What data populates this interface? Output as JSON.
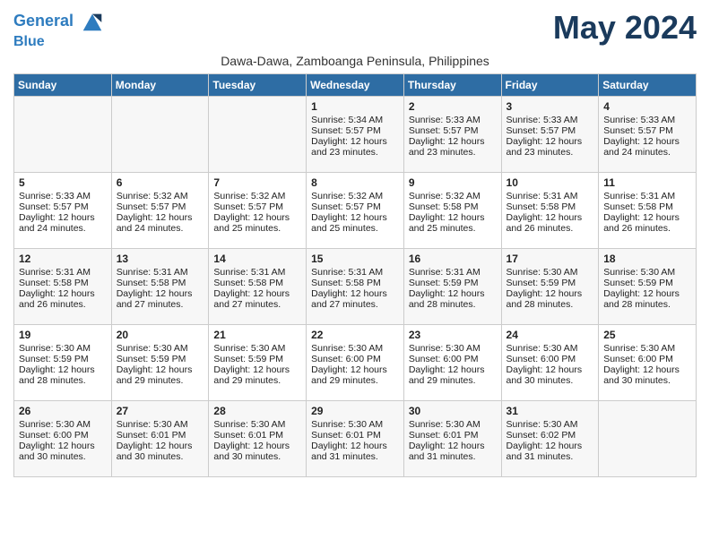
{
  "header": {
    "logo_line1": "General",
    "logo_line2": "Blue",
    "month_year": "May 2024",
    "location": "Dawa-Dawa, Zamboanga Peninsula, Philippines"
  },
  "days_of_week": [
    "Sunday",
    "Monday",
    "Tuesday",
    "Wednesday",
    "Thursday",
    "Friday",
    "Saturday"
  ],
  "weeks": [
    [
      {
        "day": "",
        "content": ""
      },
      {
        "day": "",
        "content": ""
      },
      {
        "day": "",
        "content": ""
      },
      {
        "day": "1",
        "sunrise": "Sunrise: 5:34 AM",
        "sunset": "Sunset: 5:57 PM",
        "daylight": "Daylight: 12 hours and 23 minutes."
      },
      {
        "day": "2",
        "sunrise": "Sunrise: 5:33 AM",
        "sunset": "Sunset: 5:57 PM",
        "daylight": "Daylight: 12 hours and 23 minutes."
      },
      {
        "day": "3",
        "sunrise": "Sunrise: 5:33 AM",
        "sunset": "Sunset: 5:57 PM",
        "daylight": "Daylight: 12 hours and 23 minutes."
      },
      {
        "day": "4",
        "sunrise": "Sunrise: 5:33 AM",
        "sunset": "Sunset: 5:57 PM",
        "daylight": "Daylight: 12 hours and 24 minutes."
      }
    ],
    [
      {
        "day": "5",
        "sunrise": "Sunrise: 5:33 AM",
        "sunset": "Sunset: 5:57 PM",
        "daylight": "Daylight: 12 hours and 24 minutes."
      },
      {
        "day": "6",
        "sunrise": "Sunrise: 5:32 AM",
        "sunset": "Sunset: 5:57 PM",
        "daylight": "Daylight: 12 hours and 24 minutes."
      },
      {
        "day": "7",
        "sunrise": "Sunrise: 5:32 AM",
        "sunset": "Sunset: 5:57 PM",
        "daylight": "Daylight: 12 hours and 25 minutes."
      },
      {
        "day": "8",
        "sunrise": "Sunrise: 5:32 AM",
        "sunset": "Sunset: 5:57 PM",
        "daylight": "Daylight: 12 hours and 25 minutes."
      },
      {
        "day": "9",
        "sunrise": "Sunrise: 5:32 AM",
        "sunset": "Sunset: 5:58 PM",
        "daylight": "Daylight: 12 hours and 25 minutes."
      },
      {
        "day": "10",
        "sunrise": "Sunrise: 5:31 AM",
        "sunset": "Sunset: 5:58 PM",
        "daylight": "Daylight: 12 hours and 26 minutes."
      },
      {
        "day": "11",
        "sunrise": "Sunrise: 5:31 AM",
        "sunset": "Sunset: 5:58 PM",
        "daylight": "Daylight: 12 hours and 26 minutes."
      }
    ],
    [
      {
        "day": "12",
        "sunrise": "Sunrise: 5:31 AM",
        "sunset": "Sunset: 5:58 PM",
        "daylight": "Daylight: 12 hours and 26 minutes."
      },
      {
        "day": "13",
        "sunrise": "Sunrise: 5:31 AM",
        "sunset": "Sunset: 5:58 PM",
        "daylight": "Daylight: 12 hours and 27 minutes."
      },
      {
        "day": "14",
        "sunrise": "Sunrise: 5:31 AM",
        "sunset": "Sunset: 5:58 PM",
        "daylight": "Daylight: 12 hours and 27 minutes."
      },
      {
        "day": "15",
        "sunrise": "Sunrise: 5:31 AM",
        "sunset": "Sunset: 5:58 PM",
        "daylight": "Daylight: 12 hours and 27 minutes."
      },
      {
        "day": "16",
        "sunrise": "Sunrise: 5:31 AM",
        "sunset": "Sunset: 5:59 PM",
        "daylight": "Daylight: 12 hours and 28 minutes."
      },
      {
        "day": "17",
        "sunrise": "Sunrise: 5:30 AM",
        "sunset": "Sunset: 5:59 PM",
        "daylight": "Daylight: 12 hours and 28 minutes."
      },
      {
        "day": "18",
        "sunrise": "Sunrise: 5:30 AM",
        "sunset": "Sunset: 5:59 PM",
        "daylight": "Daylight: 12 hours and 28 minutes."
      }
    ],
    [
      {
        "day": "19",
        "sunrise": "Sunrise: 5:30 AM",
        "sunset": "Sunset: 5:59 PM",
        "daylight": "Daylight: 12 hours and 28 minutes."
      },
      {
        "day": "20",
        "sunrise": "Sunrise: 5:30 AM",
        "sunset": "Sunset: 5:59 PM",
        "daylight": "Daylight: 12 hours and 29 minutes."
      },
      {
        "day": "21",
        "sunrise": "Sunrise: 5:30 AM",
        "sunset": "Sunset: 5:59 PM",
        "daylight": "Daylight: 12 hours and 29 minutes."
      },
      {
        "day": "22",
        "sunrise": "Sunrise: 5:30 AM",
        "sunset": "Sunset: 6:00 PM",
        "daylight": "Daylight: 12 hours and 29 minutes."
      },
      {
        "day": "23",
        "sunrise": "Sunrise: 5:30 AM",
        "sunset": "Sunset: 6:00 PM",
        "daylight": "Daylight: 12 hours and 29 minutes."
      },
      {
        "day": "24",
        "sunrise": "Sunrise: 5:30 AM",
        "sunset": "Sunset: 6:00 PM",
        "daylight": "Daylight: 12 hours and 30 minutes."
      },
      {
        "day": "25",
        "sunrise": "Sunrise: 5:30 AM",
        "sunset": "Sunset: 6:00 PM",
        "daylight": "Daylight: 12 hours and 30 minutes."
      }
    ],
    [
      {
        "day": "26",
        "sunrise": "Sunrise: 5:30 AM",
        "sunset": "Sunset: 6:00 PM",
        "daylight": "Daylight: 12 hours and 30 minutes."
      },
      {
        "day": "27",
        "sunrise": "Sunrise: 5:30 AM",
        "sunset": "Sunset: 6:01 PM",
        "daylight": "Daylight: 12 hours and 30 minutes."
      },
      {
        "day": "28",
        "sunrise": "Sunrise: 5:30 AM",
        "sunset": "Sunset: 6:01 PM",
        "daylight": "Daylight: 12 hours and 30 minutes."
      },
      {
        "day": "29",
        "sunrise": "Sunrise: 5:30 AM",
        "sunset": "Sunset: 6:01 PM",
        "daylight": "Daylight: 12 hours and 31 minutes."
      },
      {
        "day": "30",
        "sunrise": "Sunrise: 5:30 AM",
        "sunset": "Sunset: 6:01 PM",
        "daylight": "Daylight: 12 hours and 31 minutes."
      },
      {
        "day": "31",
        "sunrise": "Sunrise: 5:30 AM",
        "sunset": "Sunset: 6:02 PM",
        "daylight": "Daylight: 12 hours and 31 minutes."
      },
      {
        "day": "",
        "content": ""
      }
    ]
  ]
}
